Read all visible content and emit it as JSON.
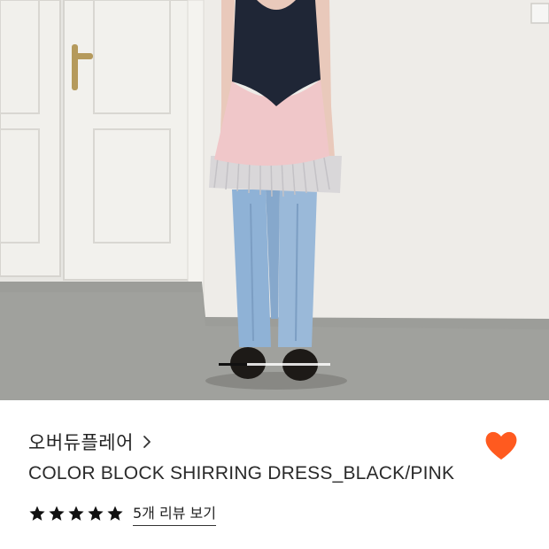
{
  "product": {
    "brand": "오버듀플레어",
    "title": "COLOR BLOCK SHIRRING DRESS_BLACK/PINK",
    "liked": true,
    "like_color": "#FF5A1F",
    "rating": 5,
    "rating_max": 5,
    "review_link_label": "5개 리뷰 보기"
  },
  "gallery": {
    "current_index": 1,
    "progress": 0.25
  },
  "icons": {
    "brand_chevron": "chevron-right-icon",
    "like": "heart-icon",
    "rating_star": "star-icon"
  }
}
